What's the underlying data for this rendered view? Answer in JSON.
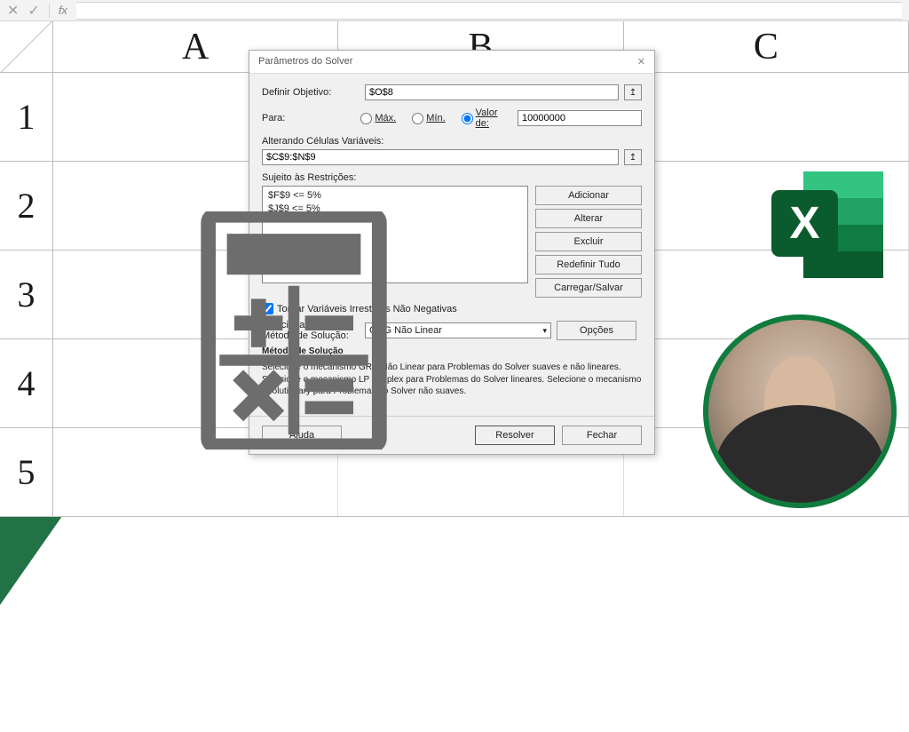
{
  "formula_bar": {
    "fx_label": "fx",
    "cancel_glyph": "✕",
    "confirm_glyph": "✓"
  },
  "sheet": {
    "columns": [
      "A",
      "B",
      "C"
    ],
    "rows": [
      "1",
      "2",
      "3",
      "4",
      "5"
    ]
  },
  "dialog": {
    "title": "Parâmetros do Solver",
    "close_glyph": "✕",
    "labels": {
      "objective": "Definir Objetivo:",
      "para": "Para:",
      "max": "Máx.",
      "min": "Mín.",
      "value_of": "Valor de:",
      "changing": "Alterando Células Variáveis:",
      "subject_to": "Sujeito às Restrições:",
      "unconstrained": "Tornar Variáveis Irrestritas Não Negativas",
      "select_method": "Selecionar um Método de Solução:",
      "method_heading": "Método de Solução",
      "method_note": "Selecione o mecanismo GRG Não Linear para Problemas do Solver suaves e não lineares. Selecione o mecanismo LP Simplex para Problemas do Solver lineares. Selecione o mecanismo Evolutionary para Problemas do Solver não suaves."
    },
    "values": {
      "objective_cell": "$O$8",
      "value_of": "10000000",
      "changing_cells": "$C$9:$N$9",
      "constraints": [
        "$F$9 <= 5%",
        "$J$9 <= 5%"
      ],
      "solving_method": "GRG Não Linear",
      "radio_selected": "value_of",
      "unconstrained_checked": true
    },
    "buttons": {
      "add": "Adicionar",
      "change": "Alterar",
      "delete": "Excluir",
      "reset": "Redefinir Tudo",
      "loadsave": "Carregar/Salvar",
      "options": "Opções",
      "help": "Ajuda",
      "solve": "Resolver",
      "close": "Fechar"
    }
  },
  "icons": {
    "calculator": "calculator-icon",
    "excel_logo": "excel-logo"
  }
}
